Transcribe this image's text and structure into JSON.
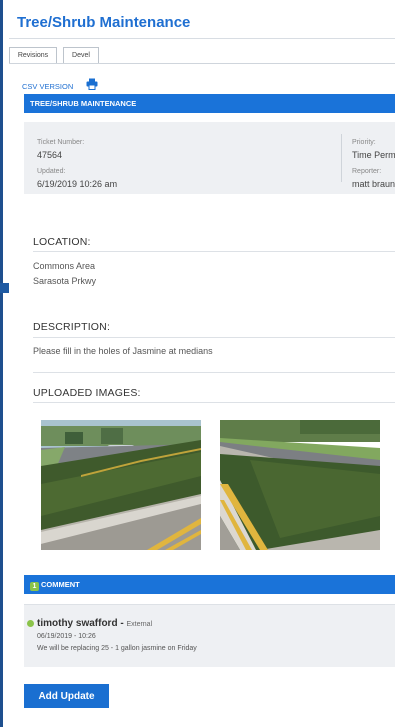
{
  "page": {
    "title": "Tree/Shrub Maintenance"
  },
  "tabs": [
    {
      "label": "Revisions"
    },
    {
      "label": "Devel"
    }
  ],
  "csv_link": {
    "label": "CSV VERSION"
  },
  "header_bar": {
    "label": "TREE/SHRUB MAINTENANCE"
  },
  "ticket": {
    "number_label": "Ticket Number:",
    "number": "47564",
    "updated_label": "Updated:",
    "updated": "6/19/2019 10:26 am",
    "priority_label": "Priority:",
    "priority": "Time Permi",
    "reporter_label": "Reporter:",
    "reporter": "matt braun"
  },
  "location": {
    "heading": "LOCATION:",
    "line1": "Commons Area",
    "line2": "Sarasota Prkwy"
  },
  "description": {
    "heading": "DESCRIPTION:",
    "text": "Please fill in the holes of Jasmine at medians"
  },
  "images": {
    "heading": "UPLOADED IMAGES:"
  },
  "comments_bar": {
    "count": "1",
    "label": "COMMENT"
  },
  "comment": {
    "author": "timothy swafford",
    "separator": " - ",
    "type": "External",
    "date": "06/19/2019 - 10:26",
    "text": "We will be replacing 25 - 1 gallon jasmine on Friday"
  },
  "actions": {
    "add_update_label": "Add Update"
  },
  "colors": {
    "accent": "#1a73d9",
    "title": "#1f6fd1",
    "status_green": "#8bc34a"
  },
  "icons": {
    "print": "printer-icon",
    "status": "status-dot-icon"
  }
}
